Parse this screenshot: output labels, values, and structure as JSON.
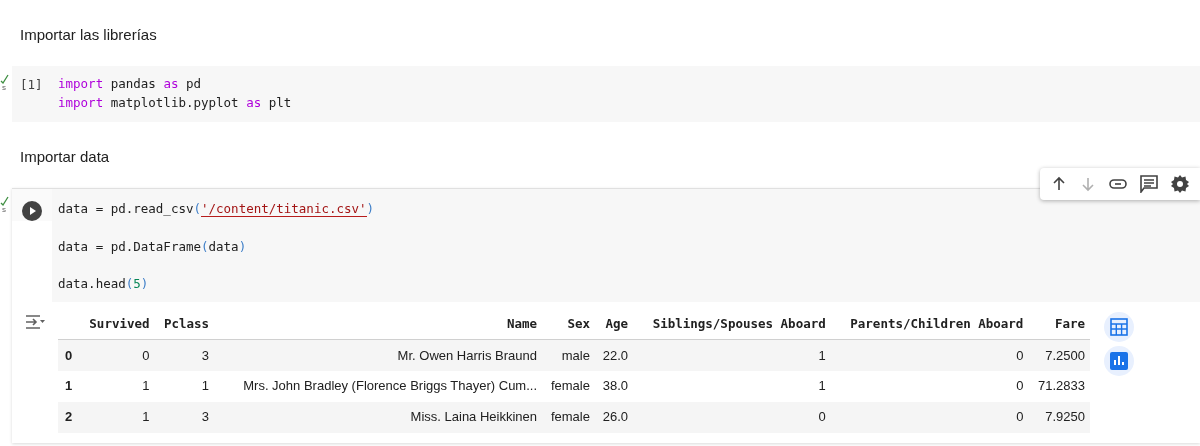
{
  "cells": [
    {
      "kind": "text",
      "text": "Importar las librerías"
    },
    {
      "kind": "code",
      "status_time": "s",
      "execution_count": "[1]",
      "focused": false,
      "lines": [
        {
          "gap_before": false,
          "tokens": [
            {
              "kind": "keyword",
              "text": "import"
            },
            {
              "kind": "plain",
              "text": " pandas "
            },
            {
              "kind": "keyword",
              "text": "as"
            },
            {
              "kind": "plain",
              "text": " pd"
            }
          ]
        },
        {
          "gap_before": false,
          "tokens": [
            {
              "kind": "keyword",
              "text": "import"
            },
            {
              "kind": "plain",
              "text": " matplotlib.pyplot "
            },
            {
              "kind": "keyword",
              "text": "as"
            },
            {
              "kind": "plain",
              "text": " plt"
            }
          ]
        }
      ]
    },
    {
      "kind": "text",
      "text": "Importar data"
    },
    {
      "kind": "code",
      "status_time": "s",
      "focused": true,
      "lines": [
        {
          "gap_before": false,
          "tokens": [
            {
              "kind": "plain",
              "text": "data = pd.read_csv"
            },
            {
              "kind": "bracket",
              "text": "("
            },
            {
              "kind": "string",
              "text": "'/content/titanic.csv'",
              "underlined": true
            },
            {
              "kind": "bracket",
              "text": ")"
            }
          ]
        },
        {
          "gap_before": true,
          "tokens": [
            {
              "kind": "plain",
              "text": "data = pd.DataFrame"
            },
            {
              "kind": "bracket",
              "text": "("
            },
            {
              "kind": "plain",
              "text": "data"
            },
            {
              "kind": "bracket",
              "text": ")"
            }
          ]
        },
        {
          "gap_before": true,
          "tokens": [
            {
              "kind": "plain",
              "text": "data.head"
            },
            {
              "kind": "bracket",
              "text": "("
            },
            {
              "kind": "number",
              "text": "5"
            },
            {
              "kind": "bracket",
              "text": ")"
            }
          ]
        }
      ],
      "output": {
        "columns": [
          "",
          "Survived",
          "Pclass",
          "Name",
          "Sex",
          "Age",
          "Siblings/Spouses Aboard",
          "Parents/Children Aboard",
          "Fare"
        ],
        "rows": [
          [
            "0",
            "0",
            "3",
            "Mr. Owen Harris Braund",
            "male",
            "22.0",
            "1",
            "0",
            "7.2500"
          ],
          [
            "1",
            "1",
            "1",
            "Mrs. John Bradley (Florence Briggs Thayer) Cum...",
            "female",
            "38.0",
            "1",
            "0",
            "71.2833"
          ],
          [
            "2",
            "1",
            "3",
            "Miss. Laina Heikkinen",
            "female",
            "26.0",
            "0",
            "0",
            "7.9250"
          ]
        ]
      }
    }
  ]
}
